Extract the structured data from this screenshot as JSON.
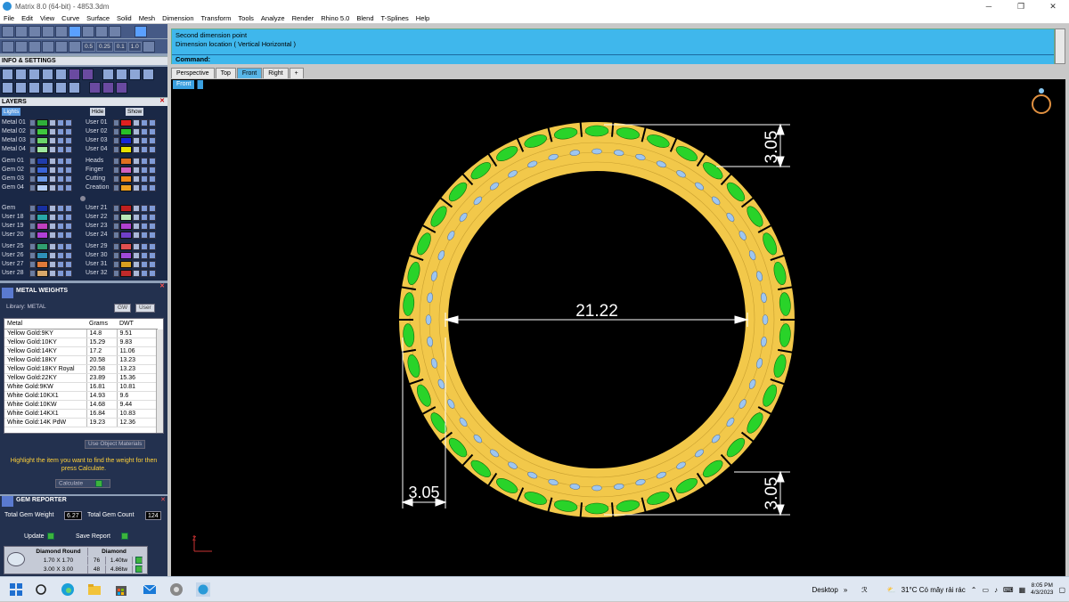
{
  "window": {
    "title": "Matrix 8.0 (64-bit) - 4853.3dm",
    "min_glyph": "─",
    "max_glyph": "❐",
    "close_glyph": "✕"
  },
  "menu": [
    "File",
    "Edit",
    "View",
    "Curve",
    "Surface",
    "Solid",
    "Mesh",
    "Dimension",
    "Transform",
    "Tools",
    "Analyze",
    "Render",
    "Rhino 5.0",
    "Blend",
    "T-Splines",
    "Help"
  ],
  "toolbar": {
    "values": [
      "0.5",
      "0.25",
      "0.1",
      "1.0"
    ]
  },
  "info_settings": {
    "title": "INFO & SETTINGS"
  },
  "layers": {
    "title": "LAYERS",
    "lights_label": "Lights",
    "hide_label": "Hide",
    "show_label": "Show",
    "left": [
      {
        "name": "Metal 01",
        "color": "#2fae3a"
      },
      {
        "name": "Metal 02",
        "color": "#3ec83e"
      },
      {
        "name": "Metal 03",
        "color": "#6ad46a"
      },
      {
        "name": "Metal 04",
        "color": "#9fe89f"
      },
      {
        "name": "Gem 01",
        "color": "#203caa"
      },
      {
        "name": "Gem 02",
        "color": "#3a64d8"
      },
      {
        "name": "Gem 03",
        "color": "#6c9ae8"
      },
      {
        "name": "Gem 04",
        "color": "#b2cdf8"
      },
      {
        "name": "Gem",
        "color": "#1830a0"
      },
      {
        "name": "User 18",
        "color": "#28a8a8"
      },
      {
        "name": "User 19",
        "color": "#c040c0"
      },
      {
        "name": "User 20",
        "color": "#b040d8"
      },
      {
        "name": "User 25",
        "color": "#30a070"
      },
      {
        "name": "User 26",
        "color": "#2e8fb8"
      },
      {
        "name": "User 27",
        "color": "#e07a3a"
      },
      {
        "name": "User 28",
        "color": "#d8a86a"
      }
    ],
    "right": [
      {
        "name": "User 01",
        "color": "#e02020"
      },
      {
        "name": "User 02",
        "color": "#28c028"
      },
      {
        "name": "User 03",
        "color": "#1828d8"
      },
      {
        "name": "User 04",
        "color": "#e8e000"
      },
      {
        "name": "Heads",
        "color": "#e07020"
      },
      {
        "name": "Finger",
        "color": "#d060c0"
      },
      {
        "name": "Cutting",
        "color": "#f08818"
      },
      {
        "name": "Creation",
        "color": "#f0a020"
      },
      {
        "name": "User 21",
        "color": "#c02020"
      },
      {
        "name": "User 22",
        "color": "#b8e8b8"
      },
      {
        "name": "User 23",
        "color": "#b040d0"
      },
      {
        "name": "User 24",
        "color": "#7040c8"
      },
      {
        "name": "User 29",
        "color": "#e05050"
      },
      {
        "name": "User 30",
        "color": "#a04ad8"
      },
      {
        "name": "User 31",
        "color": "#d8a020"
      },
      {
        "name": "User 32",
        "color": "#c02a2a"
      }
    ]
  },
  "metal_weights": {
    "title": "METAL WEIGHTS",
    "library": "Library: METAL",
    "btn_gw": "GW",
    "btn_user": "User",
    "headers": [
      "Metal",
      "Grams",
      "DWT"
    ],
    "rows": [
      [
        "Yellow Gold:9KY",
        "14.8",
        "9.51"
      ],
      [
        "Yellow Gold:10KY",
        "15.29",
        "9.83"
      ],
      [
        "Yellow Gold:14KY",
        "17.2",
        "11.06"
      ],
      [
        "Yellow Gold:18KY",
        "20.58",
        "13.23"
      ],
      [
        "Yellow Gold:18KY Royal",
        "20.58",
        "13.23"
      ],
      [
        "Yellow Gold:22KY",
        "23.89",
        "15.36"
      ],
      [
        "White Gold:9KW",
        "16.81",
        "10.81"
      ],
      [
        "White Gold:10KX1",
        "14.93",
        "9.6"
      ],
      [
        "White Gold:10KW",
        "14.68",
        "9.44"
      ],
      [
        "White Gold:14KX1",
        "16.84",
        "10.83"
      ],
      [
        "White Gold:14K PdW",
        "19.23",
        "12.36"
      ]
    ],
    "use_object_materials": "Use Object Materials",
    "hint": "Highlight the item you want to find the weight for then press Calculate.",
    "calculate": "Calculate"
  },
  "gem_reporter": {
    "title": "GEM REPORTER",
    "total_weight_label": "Total Gem Weight",
    "total_weight": "6.27",
    "total_count_label": "Total Gem Count",
    "total_count": "124",
    "update": "Update",
    "save_report": "Save Report",
    "header1": "Diamond Round",
    "header2": "Diamond",
    "rows": [
      {
        "size": "1.70 X 1.70",
        "count": "76",
        "wt": "1.40tw"
      },
      {
        "size": "3.00 X 3.00",
        "count": "48",
        "wt": "4.86tw"
      }
    ]
  },
  "command": {
    "line1": "Second dimension point",
    "line2": "Dimension location ( Vertical  Horizontal )",
    "prompt": "Command:"
  },
  "viewport_tabs": [
    {
      "label": "Perspective",
      "active": false
    },
    {
      "label": "Top",
      "active": false
    },
    {
      "label": "Front",
      "active": true
    },
    {
      "label": "Right",
      "active": false
    },
    {
      "label": "+",
      "active": false
    }
  ],
  "viewport": {
    "label": "Front",
    "dims": {
      "diameter": "21.22",
      "top_right": "3.05",
      "bottom_right": "3.05",
      "bottom_left": "3.05"
    },
    "axis_label": "Z",
    "colors": {
      "metal": "#f2c84a",
      "gem_outer": "#29d329",
      "gem_inner": "#9ec6f0",
      "cut": "#000000"
    }
  },
  "taskbar": {
    "desktop": "Desktop",
    "weather": "31°C  Có mây rải rác",
    "time": "8:05 PM",
    "date": "4/3/2023"
  }
}
